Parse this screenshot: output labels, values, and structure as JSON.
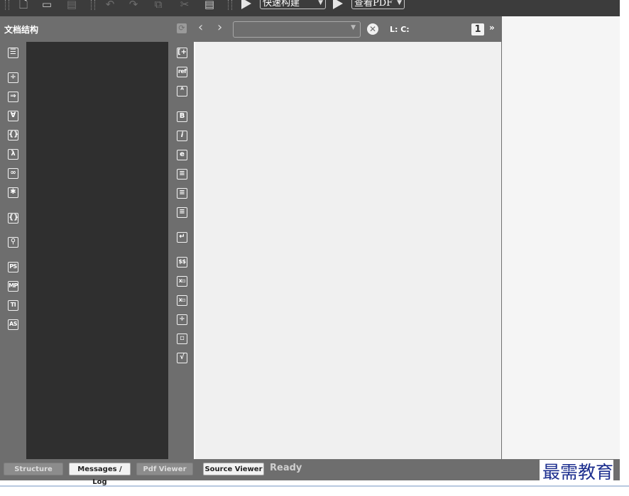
{
  "toolbar": {
    "build_combo": "快速构建",
    "view_combo": "查看PDF",
    "icons": [
      "new-file-icon",
      "open-file-icon",
      "save-icon",
      "undo-icon",
      "redo-icon",
      "copy-icon",
      "cut-icon",
      "paste-icon",
      "run-build-icon",
      "view-pdf-icon"
    ]
  },
  "structure_panel": {
    "title": "文档结构",
    "refresh_glyph": "⟳",
    "left_symbols": [
      "☰",
      "÷",
      "⇒",
      "∀",
      "{}",
      "λ",
      "∞",
      "✱",
      "{}.",
      "⚲",
      "PS",
      "MP",
      "TI",
      "AS"
    ],
    "right_symbols": [
      "[+",
      "ref",
      "ᴬ",
      "B",
      "i",
      "e",
      "≡",
      "≡",
      "≡",
      "↵",
      "$$",
      "x▫",
      "x▫",
      "÷",
      "▫",
      "√"
    ]
  },
  "editor_bar": {
    "back_glyph": "‹",
    "forward_glyph": "›",
    "file_combo_value": "",
    "close_glyph": "✕",
    "line_col": "L: C:",
    "page_badge": "1",
    "more_glyph": "»"
  },
  "status_bar": {
    "buttons": [
      "Structure",
      "Messages / Log",
      "Pdf Viewer",
      "Source Viewer"
    ],
    "status": "Ready"
  },
  "watermark": "最需教育",
  "colors": {
    "toolbar_bg": "#3c3c3c",
    "panel_bg": "#6e6e6e",
    "tree_bg": "#2f2f2f",
    "editor_bg": "#f0f0f0",
    "watermark": "#1d2f8f"
  }
}
